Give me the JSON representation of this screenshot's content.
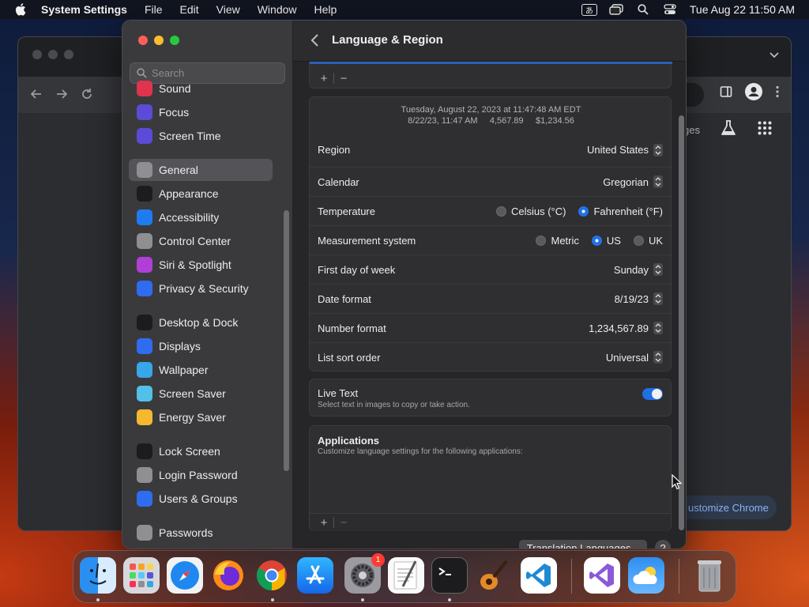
{
  "menubar": {
    "app_name": "System Settings",
    "menus": [
      "File",
      "Edit",
      "View",
      "Window",
      "Help"
    ],
    "ime_label": "あ",
    "clock": "Tue Aug 22  11:50 AM"
  },
  "chrome": {
    "page_fragment": "ges",
    "customize_label": "ustomize Chrome"
  },
  "sidebar": {
    "search_placeholder": "Search",
    "items": [
      {
        "label": "Sound",
        "icon": "speaker-icon",
        "color": "#e0334d"
      },
      {
        "label": "Focus",
        "icon": "moon-icon",
        "color": "#5b4bd6"
      },
      {
        "label": "Screen Time",
        "icon": "hourglass-icon",
        "color": "#5b4bd6"
      },
      {
        "label": "General",
        "icon": "gear-icon",
        "color": "#8e8e93"
      },
      {
        "label": "Appearance",
        "icon": "appearance-icon",
        "color": "#1c1c1e"
      },
      {
        "label": "Accessibility",
        "icon": "accessibility-icon",
        "color": "#1e7cf0"
      },
      {
        "label": "Control Center",
        "icon": "toggles-icon",
        "color": "#8e8e93"
      },
      {
        "label": "Siri & Spotlight",
        "icon": "siri-icon",
        "color": "#b03fd6"
      },
      {
        "label": "Privacy & Security",
        "icon": "hand-icon",
        "color": "#2f6cf0"
      },
      {
        "label": "Desktop & Dock",
        "icon": "dock-icon",
        "color": "#1c1c1e"
      },
      {
        "label": "Displays",
        "icon": "sun-icon",
        "color": "#2f6cf0"
      },
      {
        "label": "Wallpaper",
        "icon": "flower-icon",
        "color": "#37a7e8"
      },
      {
        "label": "Screen Saver",
        "icon": "screensaver-icon",
        "color": "#52c0e8"
      },
      {
        "label": "Energy Saver",
        "icon": "bulb-icon",
        "color": "#f5b82e"
      },
      {
        "label": "Lock Screen",
        "icon": "lock-icon",
        "color": "#1c1c1e"
      },
      {
        "label": "Login Password",
        "icon": "padlock-icon",
        "color": "#8e8e93"
      },
      {
        "label": "Users & Groups",
        "icon": "users-icon",
        "color": "#2f6cf0"
      },
      {
        "label": "Passwords",
        "icon": "key-icon",
        "color": "#8e8e93"
      }
    ],
    "selected": "General"
  },
  "content": {
    "title": "Language & Region",
    "plus": "+",
    "minus": "−",
    "preview_line1": "Tuesday, August 22, 2023 at 11:47:48 AM EDT",
    "preview_line2": "8/22/23, 11:47 AM     4,567.89     $1,234.56",
    "region": {
      "label": "Region",
      "value": "United States"
    },
    "calendar": {
      "label": "Calendar",
      "value": "Gregorian"
    },
    "temperature": {
      "label": "Temperature",
      "options": [
        "Celsius (°C)",
        "Fahrenheit (°F)"
      ],
      "selected": "Fahrenheit (°F)"
    },
    "measurement": {
      "label": "Measurement system",
      "options": [
        "Metric",
        "US",
        "UK"
      ],
      "selected": "US"
    },
    "first_day": {
      "label": "First day of week",
      "value": "Sunday"
    },
    "date_format": {
      "label": "Date format",
      "value": "8/19/23"
    },
    "number_format": {
      "label": "Number format",
      "value": "1,234,567.89"
    },
    "sort_order": {
      "label": "List sort order",
      "value": "Universal"
    },
    "live_text": {
      "label": "Live Text",
      "description": "Select text in images to copy or take action.",
      "enabled": true
    },
    "applications": {
      "title": "Applications",
      "description": "Customize language settings for the following applications:"
    },
    "translation_button": "Translation Languages...",
    "help_button": "?"
  },
  "dock": {
    "apps": [
      "Finder",
      "Launchpad",
      "Safari",
      "Firefox",
      "Chrome",
      "App Store",
      "System Settings",
      "TextEdit",
      "Terminal",
      "GarageBand",
      "VS Code",
      "Visual Studio",
      "Weather",
      "Trash"
    ],
    "settings_badge": "1"
  }
}
